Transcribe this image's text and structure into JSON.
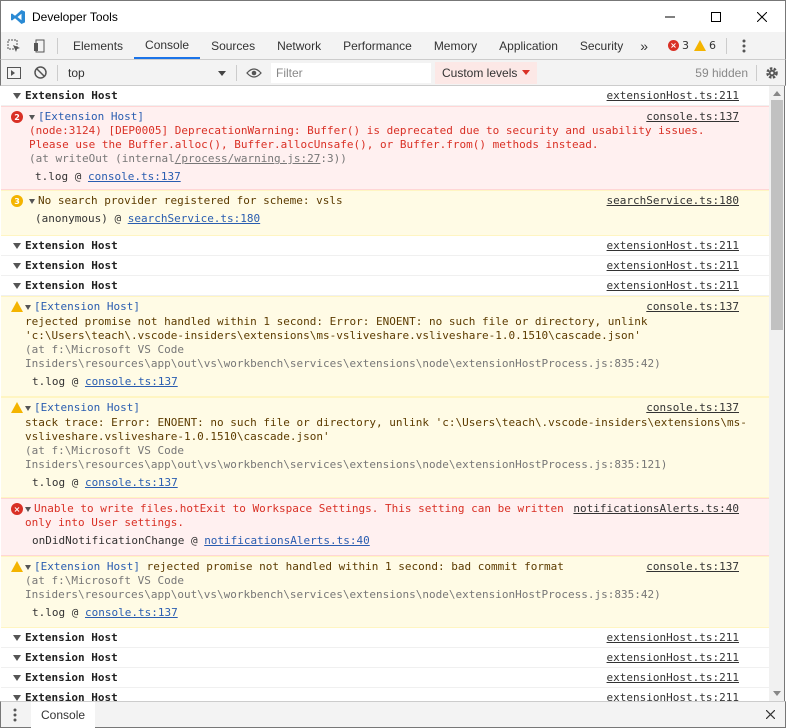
{
  "window": {
    "title": "Developer Tools"
  },
  "tabs": [
    {
      "label": "Elements"
    },
    {
      "label": "Console"
    },
    {
      "label": "Sources"
    },
    {
      "label": "Network"
    },
    {
      "label": "Performance"
    },
    {
      "label": "Memory"
    },
    {
      "label": "Application"
    },
    {
      "label": "Security"
    }
  ],
  "counters": {
    "errors": "3",
    "warnings": "6",
    "more": "»"
  },
  "toolbar": {
    "context": "top",
    "filter_placeholder": "Filter",
    "levels_label": "Custom levels",
    "hidden_count": "59 hidden"
  },
  "messages": {
    "g1": {
      "label": "Extension Host",
      "src": "extensionHost.ts:211"
    },
    "m1": {
      "badge": "2",
      "head": "[Extension Host]",
      "src": "console.ts:137",
      "l1": "(node:3124) [DEP0005] DeprecationWarning: Buffer() is deprecated due to security and usability issues.",
      "l2": "Please use the Buffer.alloc(), Buffer.allocUnsafe(), or Buffer.from() methods instead.",
      "l3a": "(at writeOut (internal",
      "l3b": "/process/warning.js:27",
      "l3c": ":3))",
      "trace_fn": "t.log @ ",
      "trace_link": "console.ts:137"
    },
    "m2": {
      "badge": "3",
      "head": "No search provider registered for scheme: vsls",
      "src": "searchService.ts:180",
      "trace_fn": "(anonymous) @ ",
      "trace_link": "searchService.ts:180"
    },
    "g2": {
      "label": "Extension Host",
      "src": "extensionHost.ts:211"
    },
    "g3": {
      "label": "Extension Host",
      "src": "extensionHost.ts:211"
    },
    "g4": {
      "label": "Extension Host",
      "src": "extensionHost.ts:211"
    },
    "m3": {
      "head": "[Extension Host]",
      "src": "console.ts:137",
      "l1": "rejected promise not handled within 1 second: Error: ENOENT: no such file or directory, unlink",
      "l2": "'c:\\Users\\teach\\.vscode-insiders\\extensions\\ms-vsliveshare.vsliveshare-1.0.1510\\cascade.json'",
      "l3": "(at f:\\Microsoft VS Code",
      "l4": "Insiders\\resources\\app\\out\\vs\\workbench\\services\\extensions\\node\\extensionHostProcess.js:835:42)",
      "trace_fn": "t.log @ ",
      "trace_link": "console.ts:137"
    },
    "m4": {
      "head": "[Extension Host]",
      "src": "console.ts:137",
      "l1": "stack trace: Error: ENOENT: no such file or directory, unlink 'c:\\Users\\teach\\.vscode-insiders\\extensions\\ms-",
      "l2": "vsliveshare.vsliveshare-1.0.1510\\cascade.json'",
      "l3": "(at f:\\Microsoft VS Code",
      "l4": "Insiders\\resources\\app\\out\\vs\\workbench\\services\\extensions\\node\\extensionHostProcess.js:835:121)",
      "trace_fn": "t.log @ ",
      "trace_link": "console.ts:137"
    },
    "m5": {
      "head": "Unable to write files.hotExit to Workspace Settings. This setting can be written",
      "l2": "only into User settings.",
      "src": "notificationsAlerts.ts:40",
      "trace_fn": "onDidNotificationChange @ ",
      "trace_link": "notificationsAlerts.ts:40"
    },
    "m6": {
      "head": "[Extension Host]",
      "head2": " rejected promise not handled within 1 second: bad commit format",
      "src": "console.ts:137",
      "l3": "(at f:\\Microsoft VS Code",
      "l4": "Insiders\\resources\\app\\out\\vs\\workbench\\services\\extensions\\node\\extensionHostProcess.js:835:42)",
      "trace_fn": "t.log @ ",
      "trace_link": "console.ts:137"
    },
    "g5": {
      "label": "Extension Host",
      "src": "extensionHost.ts:211"
    },
    "g6": {
      "label": "Extension Host",
      "src": "extensionHost.ts:211"
    },
    "g7": {
      "label": "Extension Host",
      "src": "extensionHost.ts:211"
    },
    "g8": {
      "label": "Extension Host",
      "src": "extensionHost.ts:211"
    }
  },
  "drawer": {
    "tab": "Console"
  },
  "colors": {
    "error": "#d93025",
    "warning": "#f4b400",
    "accent": "#1a73e8"
  }
}
